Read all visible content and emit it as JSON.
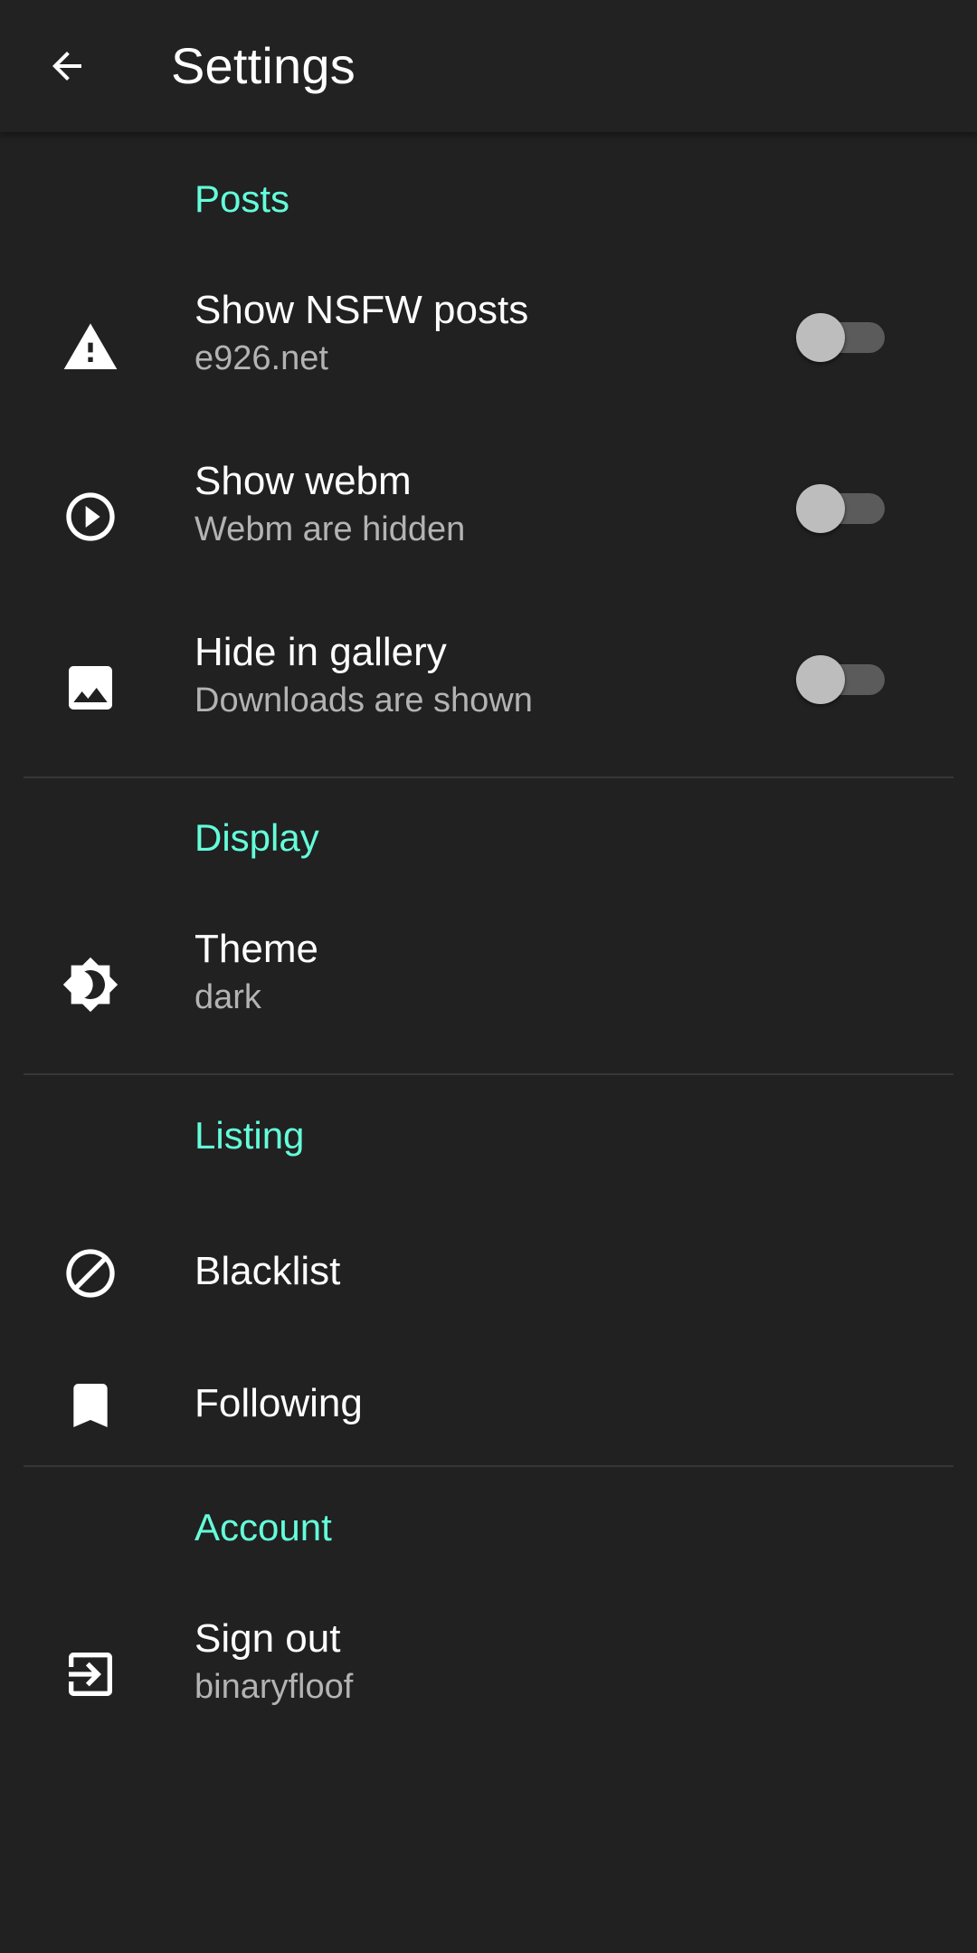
{
  "appbar": {
    "title": "Settings",
    "back_icon": "arrow-left-icon"
  },
  "sections": {
    "posts": {
      "header": "Posts",
      "items": [
        {
          "title": "Show NSFW posts",
          "subtitle": "e926.net",
          "icon": "warning-icon",
          "toggle_on": false
        },
        {
          "title": "Show webm",
          "subtitle": "Webm are hidden",
          "icon": "play-circle-icon",
          "toggle_on": false
        },
        {
          "title": "Hide in gallery",
          "subtitle": "Downloads are shown",
          "icon": "image-icon",
          "toggle_on": false
        }
      ]
    },
    "display": {
      "header": "Display",
      "items": [
        {
          "title": "Theme",
          "subtitle": "dark",
          "icon": "brightness-icon"
        }
      ]
    },
    "listing": {
      "header": "Listing",
      "items": [
        {
          "title": "Blacklist",
          "icon": "block-icon"
        },
        {
          "title": "Following",
          "icon": "bookmark-icon"
        }
      ]
    },
    "account": {
      "header": "Account",
      "items": [
        {
          "title": "Sign out",
          "subtitle": "binaryfloof",
          "icon": "logout-icon"
        }
      ]
    }
  },
  "colors": {
    "background": "#212121",
    "appbar": "#222222",
    "accent": "#64ffda",
    "text_primary": "#ffffff",
    "text_secondary": "#b3b3b3",
    "switch_track": "#5b5b5b",
    "switch_thumb": "#bdbdbd",
    "divider": "#363636"
  }
}
